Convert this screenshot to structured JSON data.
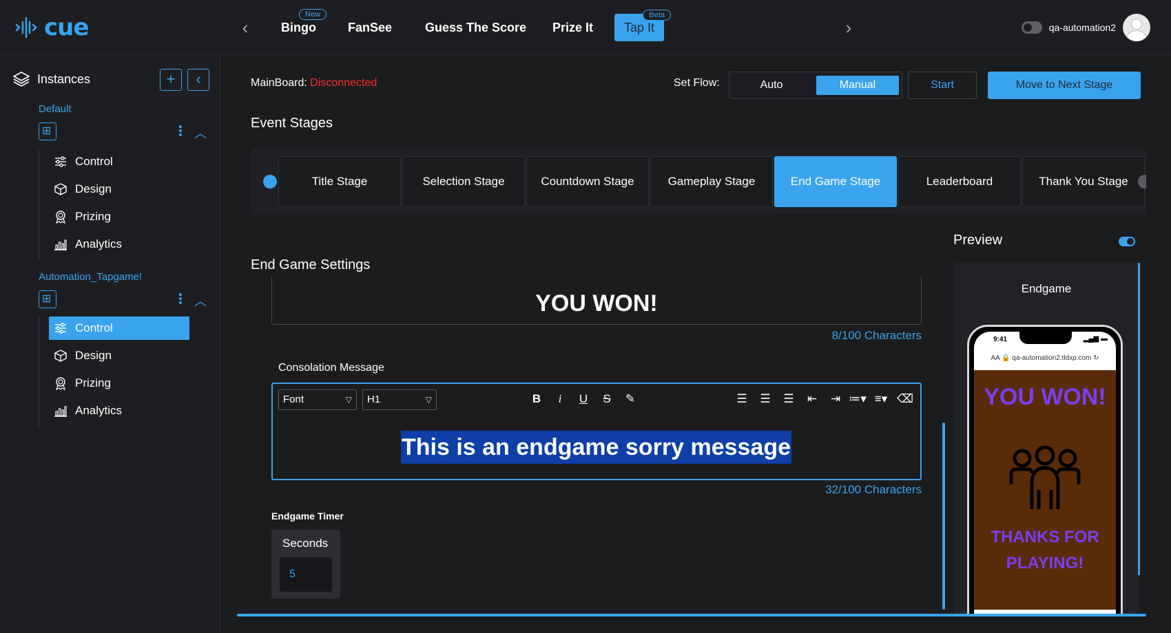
{
  "app": {
    "logo_text": "cue",
    "brand_color": "#3aa3ee"
  },
  "nav": {
    "items": [
      {
        "label": "Bingo",
        "badge": "New"
      },
      {
        "label": "FanSee",
        "badge": ""
      },
      {
        "label": "Guess The Score",
        "badge": ""
      },
      {
        "label": "Prize It",
        "badge": ""
      },
      {
        "label": "Tap It",
        "badge": "Beta"
      }
    ],
    "active_index": 4
  },
  "user": {
    "name": "qa-automation2"
  },
  "sidebar": {
    "title": "Instances",
    "groups": [
      {
        "name": "Default",
        "items": [
          "Control",
          "Design",
          "Prizing",
          "Analytics"
        ],
        "active_item": null
      },
      {
        "name": "Automation_Tapgame!",
        "items": [
          "Control",
          "Design",
          "Prizing",
          "Analytics"
        ],
        "active_item": 0
      }
    ]
  },
  "header": {
    "mainboard_label": "MainBoard:",
    "mainboard_status": "Disconnected",
    "status_color": "#ff2d2d",
    "set_flow_label": "Set Flow:",
    "flow_options": [
      "Auto",
      "Manual"
    ],
    "flow_selected": "Manual",
    "start_label": "Start",
    "next_stage_label": "Move to Next Stage"
  },
  "stages": {
    "title": "Event Stages",
    "items": [
      "Title Stage",
      "Selection Stage",
      "Countdown Stage",
      "Gameplay Stage",
      "End Game Stage",
      "Leaderboard",
      "Thank You Stage"
    ],
    "active": "End Game Stage"
  },
  "settings": {
    "title": "End Game Settings",
    "win_message": "YOU WON!",
    "win_count": "8/100 Characters",
    "consolation_label": "Consolation Message",
    "font_select": "Font",
    "heading_select": "H1",
    "consolation_message": "This is an endgame sorry message",
    "consolation_count": "32/100 Characters",
    "timer_label": "Endgame Timer",
    "timer_unit": "Seconds",
    "timer_value": "5"
  },
  "preview": {
    "title": "Preview",
    "enabled": true,
    "screen_label": "Endgame",
    "phone_time": "9:41",
    "phone_url": "qa-automation2.tldxp.com",
    "phone_url_prefix": "AA",
    "headline": "YOU WON!",
    "footer_line1": "THANKS FOR",
    "footer_line2": "PLAYING!",
    "background_color": "#5a2b08",
    "text_color": "#7a3ff0"
  }
}
